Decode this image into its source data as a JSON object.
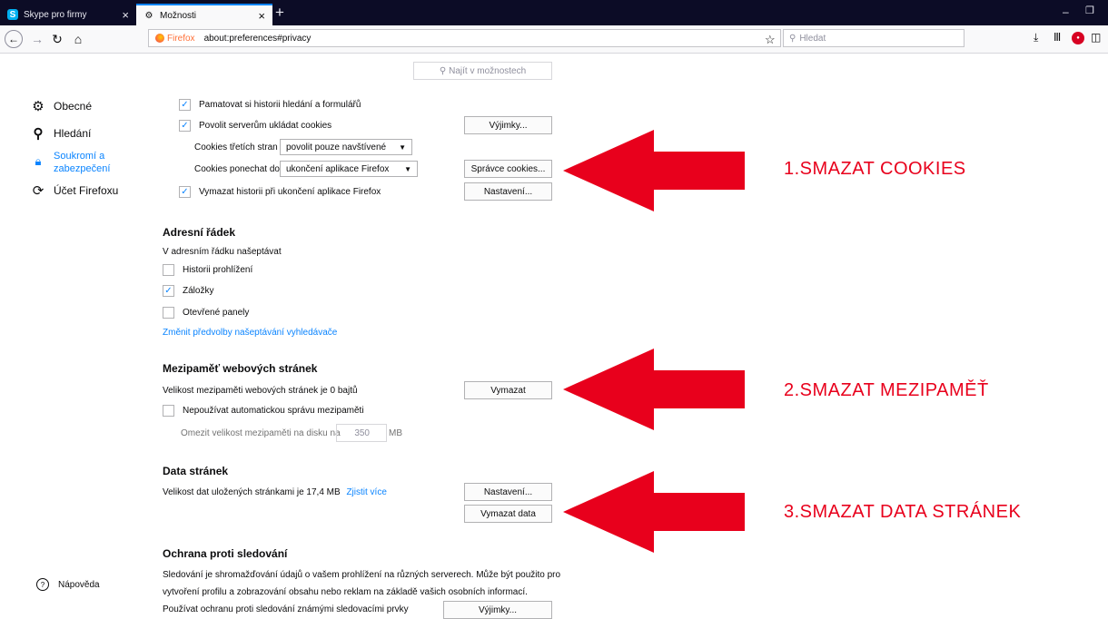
{
  "tabs": [
    {
      "title": "Skype pro firmy",
      "icon": "skype-icon"
    },
    {
      "title": "Možnosti",
      "icon": "gear-icon"
    }
  ],
  "urlbar": {
    "identity": "Firefox",
    "url": "about:preferences#privacy"
  },
  "search": {
    "placeholder": "Hledat"
  },
  "find": {
    "placeholder": "Najít v možnostech"
  },
  "categories": [
    {
      "label": "Obecné",
      "icon": "gear-icon"
    },
    {
      "label": "Hledání",
      "icon": "search-icon"
    },
    {
      "label": "Soukromí a zabezpečení",
      "icon": "lock-icon",
      "selected": true
    },
    {
      "label": "Účet Firefoxu",
      "icon": "sync-icon"
    }
  ],
  "help_label": "Nápověda",
  "history": {
    "remember_search": "Pamatovat si historii hledání a formulářů",
    "accept_cookies": "Povolit serverům ukládat cookies",
    "exceptions_btn": "Výjimky...",
    "third_party_label": "Cookies třetích stran",
    "third_party_value": "povolit pouze navštívené",
    "keep_until_label": "Cookies ponechat do",
    "keep_until_value": "ukončení aplikace Firefox",
    "manage_cookies_btn": "Správce cookies...",
    "clear_on_close": "Vymazat historii při ukončení aplikace Firefox",
    "settings_btn": "Nastavení..."
  },
  "address_bar": {
    "title": "Adresní řádek",
    "subtitle": "V adresním řádku našeptávat",
    "options": [
      {
        "label": "Historii prohlížení",
        "checked": false
      },
      {
        "label": "Záložky",
        "checked": true
      },
      {
        "label": "Otevřené panely",
        "checked": false
      }
    ],
    "link": "Změnit předvolby našeptávání vyhledávače"
  },
  "cache": {
    "title": "Mezipaměť webových stránek",
    "size_text": "Velikost mezipaměti webových stránek je 0 bajtů",
    "clear_btn": "Vymazat",
    "override": "Nepoužívat automatickou správu mezipaměti",
    "limit_label": "Omezit velikost mezipaměti na disku na",
    "limit_value": "350",
    "limit_unit": "MB"
  },
  "site_data": {
    "title": "Data stránek",
    "size_text": "Velikost dat uložených stránkami je 17,4 MB",
    "learn_more": "Zjistit více",
    "settings_btn": "Nastavení...",
    "clear_btn": "Vymazat data"
  },
  "tracking": {
    "title": "Ochrana proti sledování",
    "desc1": "Sledování je shromažďování údajů o vašem prohlížení na různých serverech. Může být použito pro",
    "desc2": "vytvoření profilu a zobrazování obsahu nebo reklam na základě vašich osobních informací.",
    "use_label": "Používat ochranu proti sledování známými sledovacími prvky",
    "exceptions_btn": "Výjimky..."
  },
  "annotations": {
    "step1": "1.SMAZAT COOKIES",
    "step2": "2.SMAZAT MEZIPAMĚŤ",
    "step3": "3.SMAZAT DATA STRÁNEK",
    "color": "#e8001c"
  }
}
